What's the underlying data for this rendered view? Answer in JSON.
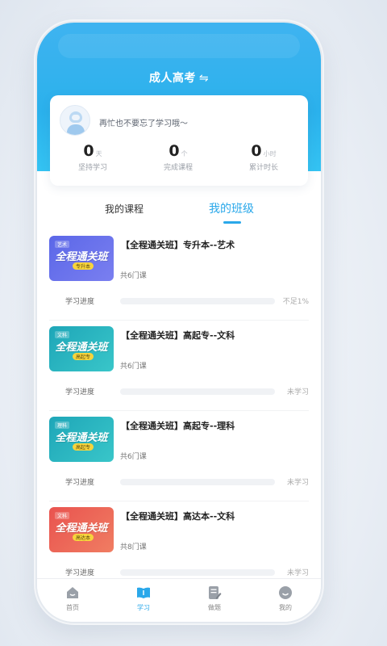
{
  "header": {
    "title": "成人高考",
    "swap_glyph": "⇋"
  },
  "stats_card": {
    "motto": "再忙也不要忘了学习哦～",
    "stats": [
      {
        "value": "0",
        "unit": "天",
        "label": "坚持学习"
      },
      {
        "value": "0",
        "unit": "个",
        "label": "完成课程"
      },
      {
        "value": "0",
        "unit": "小时",
        "label": "累计时长"
      }
    ]
  },
  "tabs": {
    "my_courses": "我的课程",
    "my_classes": "我的班级",
    "active": "my_classes"
  },
  "courses": [
    {
      "title": "【全程通关班】专升本--艺术",
      "count": "共6门课",
      "progress_label": "学习进度",
      "status": "不足1%",
      "progress": 0,
      "thumb": {
        "tag": "艺术",
        "banner": "全程通关班",
        "chip": "专升本",
        "color_from": "#5b67e8",
        "color_to": "#7a7ff0"
      }
    },
    {
      "title": "【全程通关班】高起专--文科",
      "count": "共6门课",
      "progress_label": "学习进度",
      "status": "未学习",
      "progress": 0,
      "thumb": {
        "tag": "文科",
        "banner": "全程通关班",
        "chip": "高起专",
        "color_from": "#1ea6b8",
        "color_to": "#39c6c9"
      }
    },
    {
      "title": "【全程通关班】高起专--理科",
      "count": "共6门课",
      "progress_label": "学习进度",
      "status": "未学习",
      "progress": 0,
      "thumb": {
        "tag": "理科",
        "banner": "全程通关班",
        "chip": "高起专",
        "color_from": "#1ea6b8",
        "color_to": "#39c6c9"
      }
    },
    {
      "title": "【全程通关班】高达本--文科",
      "count": "共8门课",
      "progress_label": "学习进度",
      "status": "未学习",
      "progress": 0,
      "thumb": {
        "tag": "文科",
        "banner": "全程通关班",
        "chip": "高达本",
        "color_from": "#e9534f",
        "color_to": "#f07d62"
      }
    }
  ],
  "tabbar": [
    {
      "label": "首页",
      "icon": "home-icon",
      "active": false
    },
    {
      "label": "学习",
      "icon": "book-icon",
      "active": true
    },
    {
      "label": "做题",
      "icon": "exercise-icon",
      "active": false
    },
    {
      "label": "我的",
      "icon": "profile-icon",
      "active": false
    }
  ],
  "colors": {
    "accent": "#2aa8ea",
    "header_blue": "#2bb1ec"
  }
}
